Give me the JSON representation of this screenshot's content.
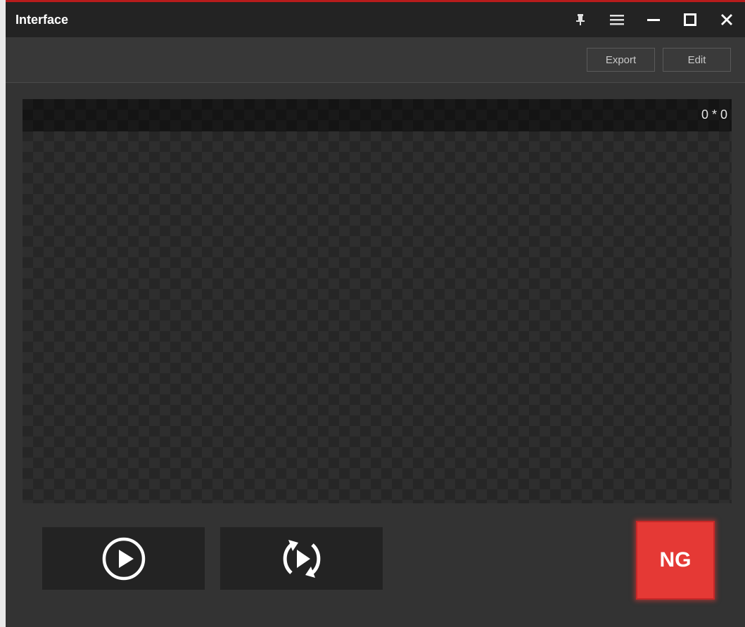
{
  "window": {
    "title": "Interface"
  },
  "titlebar_icons": [
    "pin-icon",
    "menu-icon",
    "minimize-icon",
    "maximize-icon",
    "close-icon"
  ],
  "toolbar": {
    "export_label": "Export",
    "edit_label": "Edit"
  },
  "viewer": {
    "dimensions": "0 * 0"
  },
  "controls": {
    "play_icon": "play-circle-icon",
    "loop_icon": "loop-play-icon"
  },
  "status": {
    "label": "NG",
    "color": "#e53935"
  },
  "colors": {
    "accent": "#b71c1c",
    "background": "#333333",
    "titlebar": "#232323"
  }
}
